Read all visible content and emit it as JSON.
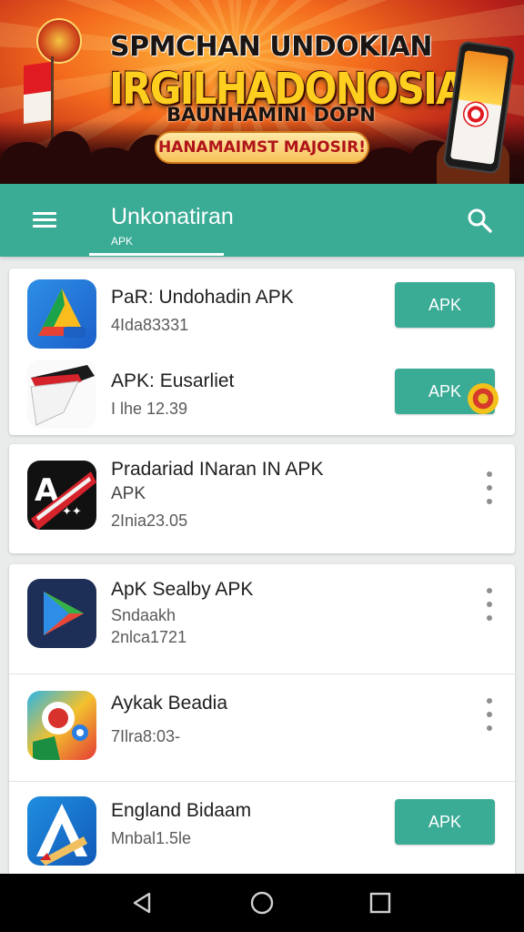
{
  "banner": {
    "line1": "SPMCHAN UNDOKIAN",
    "line2": "IRGILHADONOSIA!",
    "line3": "BAUNHAMINI DOPN",
    "pill": "HANAMAIMST MAJOSIR!",
    "colors": {
      "gold": "#ffcf1f",
      "red": "#e01b22"
    }
  },
  "appbar": {
    "title": "Unkonatiran",
    "subtab": "APK",
    "background": "#3aab95",
    "menu_icon": "hamburger-menu-icon",
    "search_icon": "search-icon"
  },
  "cards": [
    {
      "items": [
        {
          "name": "PaR: Undohadin APK",
          "sub": "4Ida83331",
          "action": "APK",
          "icon": "triangle-a-app-icon"
        },
        {
          "name": "APK: Eusarliet",
          "sub": "I lhe 12.39",
          "action": "APK",
          "icon": "flag-page-app-icon"
        }
      ]
    },
    {
      "items": [
        {
          "name": "Pradariad INaran IN APK",
          "sub1": "APK",
          "sub2": "2Inia23.05",
          "icon": "letter-a-banner-app-icon"
        }
      ]
    },
    {
      "items": [
        {
          "name": "ApK Sealby APK",
          "sub1": "Sndaakh",
          "sub2": "2nlca1721",
          "icon": "play-triangle-app-icon"
        },
        {
          "name": "Aykak Beadia",
          "sub1": "7Ilra8:03-",
          "icon": "colorful-badge-app-icon"
        },
        {
          "name": "England Bidaam",
          "sub1": "Mnbal1.5le",
          "action": "APK",
          "icon": "letter-a-pen-app-icon"
        }
      ]
    }
  ],
  "navbar": {
    "back_icon": "back-triangle-icon",
    "home_icon": "home-circle-icon",
    "recents_icon": "recents-square-icon"
  }
}
